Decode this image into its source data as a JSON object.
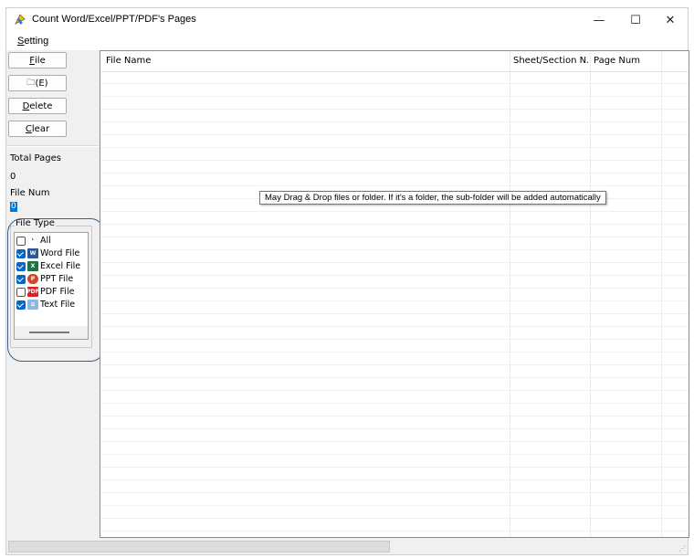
{
  "window": {
    "title": "Count Word/Excel/PPT/PDF's Pages"
  },
  "titlebar": {
    "minimize": "—",
    "maximize": "☐",
    "close": "✕"
  },
  "menu": {
    "setting_prefix": "",
    "setting_mnemonic": "S",
    "setting_rest": "etting"
  },
  "buttons": {
    "file_mnemonic": "F",
    "file_rest": "ile",
    "open_label": "(E)",
    "delete_mnemonic": "D",
    "delete_rest": "elete",
    "clear_mnemonic": "C",
    "clear_rest": "lear"
  },
  "stats": {
    "total_pages_label": "Total Pages",
    "total_pages_value": "0",
    "file_num_label": "File Num",
    "file_num_value": "0"
  },
  "file_type": {
    "label": "File Type",
    "items": [
      {
        "label": "All",
        "checked": false,
        "icon": "all-icon",
        "color": "#ffffff"
      },
      {
        "label": "Word File",
        "checked": true,
        "icon": "word-icon",
        "color": "#2b5797"
      },
      {
        "label": "Excel File",
        "checked": true,
        "icon": "excel-icon",
        "color": "#1e7145"
      },
      {
        "label": "PPT File",
        "checked": true,
        "icon": "ppt-icon",
        "color": "#d24726"
      },
      {
        "label": "PDF File",
        "checked": false,
        "icon": "pdf-icon",
        "color": "#e02020"
      },
      {
        "label": "Text File",
        "checked": true,
        "icon": "text-icon",
        "color": "#4a90d9"
      }
    ]
  },
  "grid": {
    "columns": [
      "File Name",
      "Sheet/Section N...",
      "Page Num"
    ],
    "tooltip": "May Drag & Drop files or folder. If it's a folder, the sub-folder will be added automatically"
  },
  "colors": {
    "accent": "#0078d7",
    "annotation": "#3a5f8c"
  }
}
